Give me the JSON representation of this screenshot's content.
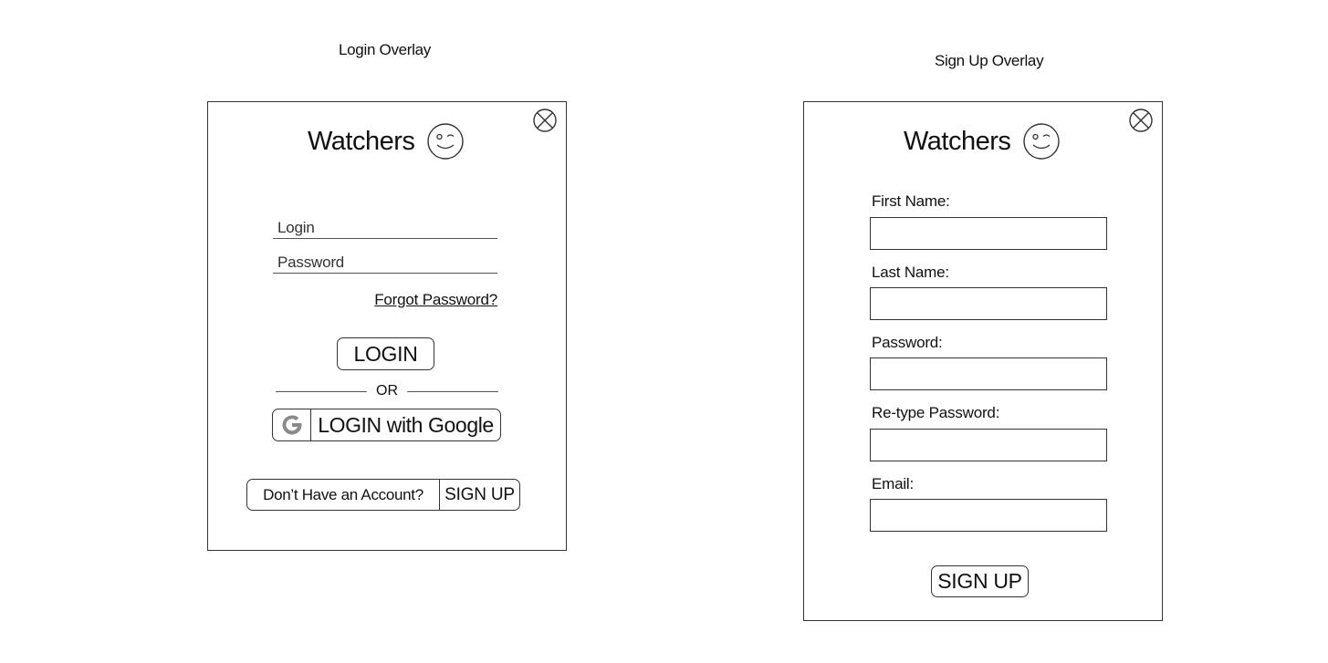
{
  "login_overlay": {
    "caption": "Login Overlay",
    "brand_name": "Watchers",
    "login_placeholder": "Login",
    "password_placeholder": "Password",
    "forgot_password": "Forgot Password?",
    "login_button": "LOGIN",
    "or_text": "OR",
    "google_button": "LOGIN with Google",
    "no_account_text": "Don’t Have an Account?",
    "signup_button": "SIGN UP"
  },
  "signup_overlay": {
    "caption": "Sign Up Overlay",
    "brand_name": "Watchers",
    "fields": [
      {
        "label": "First Name:",
        "value": ""
      },
      {
        "label": "Last Name:",
        "value": ""
      },
      {
        "label": "Password:",
        "value": ""
      },
      {
        "label": "Re-type Password:",
        "value": ""
      },
      {
        "label": "Email:",
        "value": ""
      }
    ],
    "signup_button": "SIGN UP"
  },
  "icons": {
    "close": "close-icon",
    "logo": "wink-face-icon",
    "google": "google-g-icon"
  },
  "colors": {
    "border": "#333333",
    "google_g": "#8a8a8a"
  }
}
